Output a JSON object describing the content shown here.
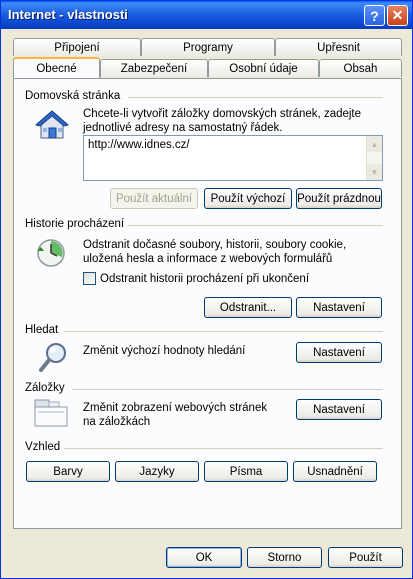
{
  "window": {
    "title": "Internet - vlastnosti",
    "help_glyph": "?",
    "close_glyph": "✕"
  },
  "tabs": {
    "row1": [
      "Připojení",
      "Programy",
      "Upřesnit"
    ],
    "row2": [
      "Obecné",
      "Zabezpečení",
      "Osobní údaje",
      "Obsah"
    ],
    "active": "Obecné"
  },
  "home": {
    "heading": "Domovská stránka",
    "description": "Chcete-li vytvořit záložky domovských stránek, zadejte jednotlivé adresy na samostatný řádek.",
    "url": "http://www.idnes.cz/",
    "buttons": {
      "current": "Použít aktuální",
      "default": "Použít výchozí",
      "blank": "Použít prázdnou"
    }
  },
  "history": {
    "heading": "Historie procházení",
    "description": "Odstranit dočasné soubory, historii, soubory cookie, uložená hesla a informace z webových formulářů",
    "checkbox_label": "Odstranit historii procházení při ukončení",
    "checkbox_checked": false,
    "buttons": {
      "delete": "Odstranit...",
      "settings": "Nastavení"
    }
  },
  "search": {
    "heading": "Hledat",
    "description": "Změnit výchozí hodnoty hledání",
    "settings_label": "Nastavení"
  },
  "tabsgroup": {
    "heading": "Záložky",
    "description": "Změnit zobrazení webových stránek na záložkách",
    "settings_label": "Nastavení"
  },
  "appearance": {
    "heading": "Vzhled",
    "buttons": {
      "colors": "Barvy",
      "languages": "Jazyky",
      "fonts": "Písma",
      "accessibility": "Usnadnění"
    }
  },
  "footer": {
    "ok": "OK",
    "cancel": "Storno",
    "apply": "Použít"
  },
  "colors": {
    "title_blue": "#0b47d0",
    "face": "#ece9d8",
    "panel": "#fcfcfe",
    "tab_accent": "#f7b540"
  }
}
